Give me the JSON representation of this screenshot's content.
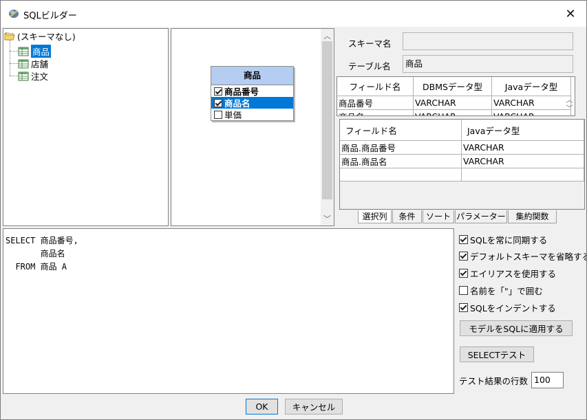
{
  "window": {
    "title": "SQLビルダー",
    "close_glyph": "✕"
  },
  "tree": {
    "root_label": "(スキーマなし)",
    "items": [
      {
        "label": "商品",
        "selected": true
      },
      {
        "label": "店舗",
        "selected": false
      },
      {
        "label": "注文",
        "selected": false
      }
    ]
  },
  "entity": {
    "title": "商品",
    "fields": [
      {
        "label": "商品番号",
        "checked": true
      },
      {
        "label": "商品名",
        "checked": true
      },
      {
        "label": "単価",
        "checked": false
      }
    ]
  },
  "properties": {
    "schema_label": "スキーマ名",
    "schema_value": "",
    "table_label": "テーブル名",
    "table_value": "商品"
  },
  "field_table": {
    "headers": [
      "フィールド名",
      "DBMSデータ型",
      "Javaデータ型"
    ],
    "rows": [
      [
        "商品番号",
        "VARCHAR",
        "VARCHAR"
      ],
      [
        "商品名",
        "VARCHAR",
        "VARCHAR"
      ]
    ]
  },
  "select_table": {
    "headers": [
      "フィールド名",
      "Javaデータ型"
    ],
    "rows": [
      [
        "商品.商品番号",
        "VARCHAR"
      ],
      [
        "商品.商品名",
        "VARCHAR"
      ],
      [
        "",
        ""
      ]
    ]
  },
  "tabs": [
    "選択列",
    "条件",
    "ソート",
    "パラメーター",
    "集約関数"
  ],
  "sql_text": "SELECT 商品番号,\n       商品名\n  FROM 商品 A",
  "options": [
    {
      "label": "SQLを常に同期する",
      "checked": true
    },
    {
      "label": "デフォルトスキーマを省略する",
      "checked": true
    },
    {
      "label": "エイリアスを使用する",
      "checked": true
    },
    {
      "label": "名前を「\"」で囲む",
      "checked": false
    },
    {
      "label": "SQLをインデントする",
      "checked": true
    }
  ],
  "buttons": {
    "apply_model": "モデルをSQLに適用する",
    "select_test": "SELECTテスト",
    "ok": "OK",
    "cancel": "キャンセル"
  },
  "test_rows": {
    "label": "テスト結果の行数",
    "value": "100"
  }
}
